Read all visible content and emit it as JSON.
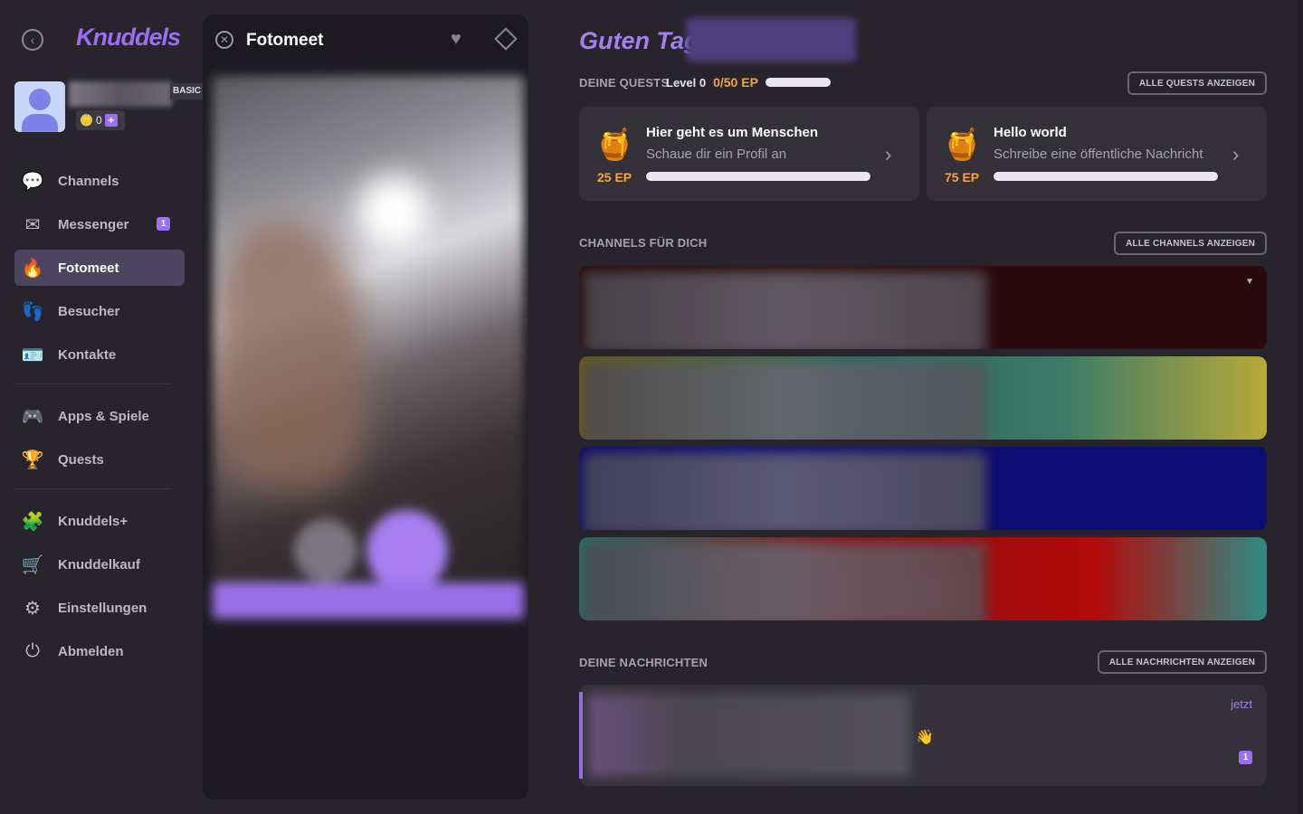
{
  "app": {
    "logo": "Knuddels",
    "back_icon": "chevron-left-icon"
  },
  "profile": {
    "badge": "BASIC",
    "coins": "0",
    "plus_label": "+"
  },
  "sidebar": {
    "items": [
      {
        "label": "Channels",
        "icon": "chat-bubble-icon"
      },
      {
        "label": "Messenger",
        "icon": "envelope-icon",
        "count": "1"
      },
      {
        "label": "Fotomeet",
        "icon": "flame-icon",
        "active": true
      },
      {
        "label": "Besucher",
        "icon": "visitors-icon"
      },
      {
        "label": "Kontakte",
        "icon": "contacts-card-icon"
      },
      {
        "label": "Apps & Spiele",
        "icon": "gamepad-icon"
      },
      {
        "label": "Quests",
        "icon": "trophy-icon"
      },
      {
        "label": "Knuddels+",
        "icon": "puzzle-plus-icon"
      },
      {
        "label": "Knuddelkauf",
        "icon": "shopping-cart-icon"
      },
      {
        "label": "Einstellungen",
        "icon": "gear-icon"
      },
      {
        "label": "Abmelden",
        "icon": "power-icon"
      }
    ]
  },
  "fotomeet": {
    "title": "Fotomeet"
  },
  "main": {
    "greeting": "Guten Tag,",
    "quests": {
      "label": "DEINE QUESTS",
      "level": "Level 0",
      "ep": "0/50 EP",
      "ep_progress": 0,
      "all_button": "ALLE QUESTS ANZEIGEN",
      "cards": [
        {
          "title": "Hier geht es um Menschen",
          "desc": "Schaue dir ein Profil an",
          "ep": "25 EP",
          "progress": 0
        },
        {
          "title": "Hello world",
          "desc": "Schreibe eine öffentliche Nachricht",
          "ep": "75 EP",
          "progress": 0
        }
      ]
    },
    "channels": {
      "label": "CHANNELS FÜR DICH",
      "all_button": "ALLE CHANNELS ANZEIGEN",
      "colors": [
        "#2a0a0c",
        "linear-gradient(90deg,#6b5a1c 0%,#2b6a5c 40%,#3a7a66 70%,#b7a93a 100%)",
        "#0c0c72",
        "linear-gradient(90deg,#2a6e66 0%,#8b0e0e 40%,#b20a0a 75%,#2f8b83 100%)"
      ]
    },
    "messages": {
      "label": "DEINE NACHRICHTEN",
      "all_button": "ALLE NACHRICHTEN ANZEIGEN",
      "item": {
        "emoji": "👋",
        "time": "jetzt",
        "unread": "1"
      }
    }
  }
}
